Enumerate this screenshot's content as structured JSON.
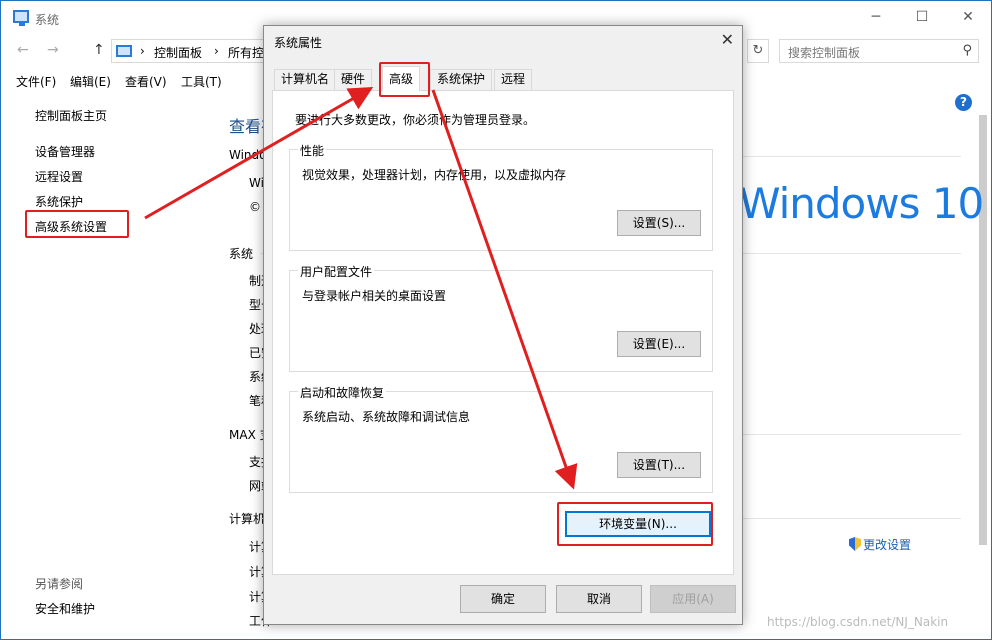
{
  "window": {
    "title": "系统",
    "minimize": "─",
    "maximize": "☐",
    "close": "✕"
  },
  "address": {
    "back": "←",
    "forward": "→",
    "up": "↑",
    "crumb_sep": "›",
    "crumb_1": "控制面板",
    "crumb_2": "所有控",
    "refresh": "↻",
    "search_placeholder": "搜索控制面板",
    "search_icon": "⚲"
  },
  "menu": [
    "文件(F)",
    "编辑(E)",
    "查看(V)",
    "工具(T)"
  ],
  "sidebar": {
    "items": [
      "控制面板主页",
      "设备管理器",
      "远程设置",
      "系统保护",
      "高级系统设置"
    ],
    "see_also": "另请参阅",
    "footer_link": "安全和维护"
  },
  "help_icon": "?",
  "main": {
    "title": "查看有",
    "windows_section": "Windo",
    "win_edition": "Win",
    "copyright": "©",
    "system_section": "系统",
    "system_items": [
      "制造",
      "型号",
      "处理",
      "已安",
      "系统",
      "笔和"
    ],
    "max_section": "MAX 支",
    "max_items": [
      "支持",
      "网站"
    ],
    "computer_section": "计算机",
    "computer_items": [
      "计算",
      "计算",
      "计算",
      "工作"
    ],
    "logo": "Windows 10",
    "change_settings": "更改设置",
    "watermark": "https://blog.csdn.net/NJ_Nakin"
  },
  "dialog": {
    "title": "系统属性",
    "close": "✕",
    "tabs": [
      "计算机名",
      "硬件",
      "高级",
      "系统保护",
      "远程"
    ],
    "active_tab": "高级",
    "notice": "要进行大多数更改，你必须作为管理员登录。",
    "groups": [
      {
        "label": "性能",
        "desc": "视觉效果，处理器计划，内存使用，以及虚拟内存",
        "button": "设置(S)..."
      },
      {
        "label": "用户配置文件",
        "desc": "与登录帐户相关的桌面设置",
        "button": "设置(E)..."
      },
      {
        "label": "启动和故障恢复",
        "desc": "系统启动、系统故障和调试信息",
        "button": "设置(T)..."
      }
    ],
    "env_button": "环境变量(N)...",
    "ok": "确定",
    "cancel": "取消",
    "apply": "应用(A)"
  },
  "annotation_color": "#e02020"
}
